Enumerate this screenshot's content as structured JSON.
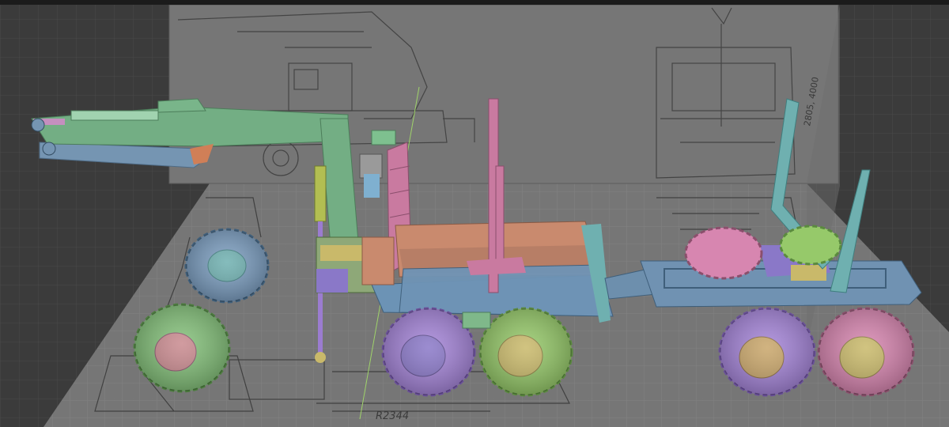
{
  "viewport": {
    "corner_label": "",
    "blueprint_labels": {
      "side_dimension": "2805, 4000",
      "bottom_dimension": "R2344"
    }
  },
  "colors": {
    "grid_bg": "#3a3a3a",
    "board": "#7a7a7a",
    "crane_green": "#6fae82",
    "blue_gray": "#6d8fad",
    "pink": "#c9708f",
    "salmon": "#c98a6e",
    "teal": "#6fb0b0",
    "purple": "#9a78c8",
    "yellow": "#c9b96a",
    "olive": "#a9b84f"
  }
}
